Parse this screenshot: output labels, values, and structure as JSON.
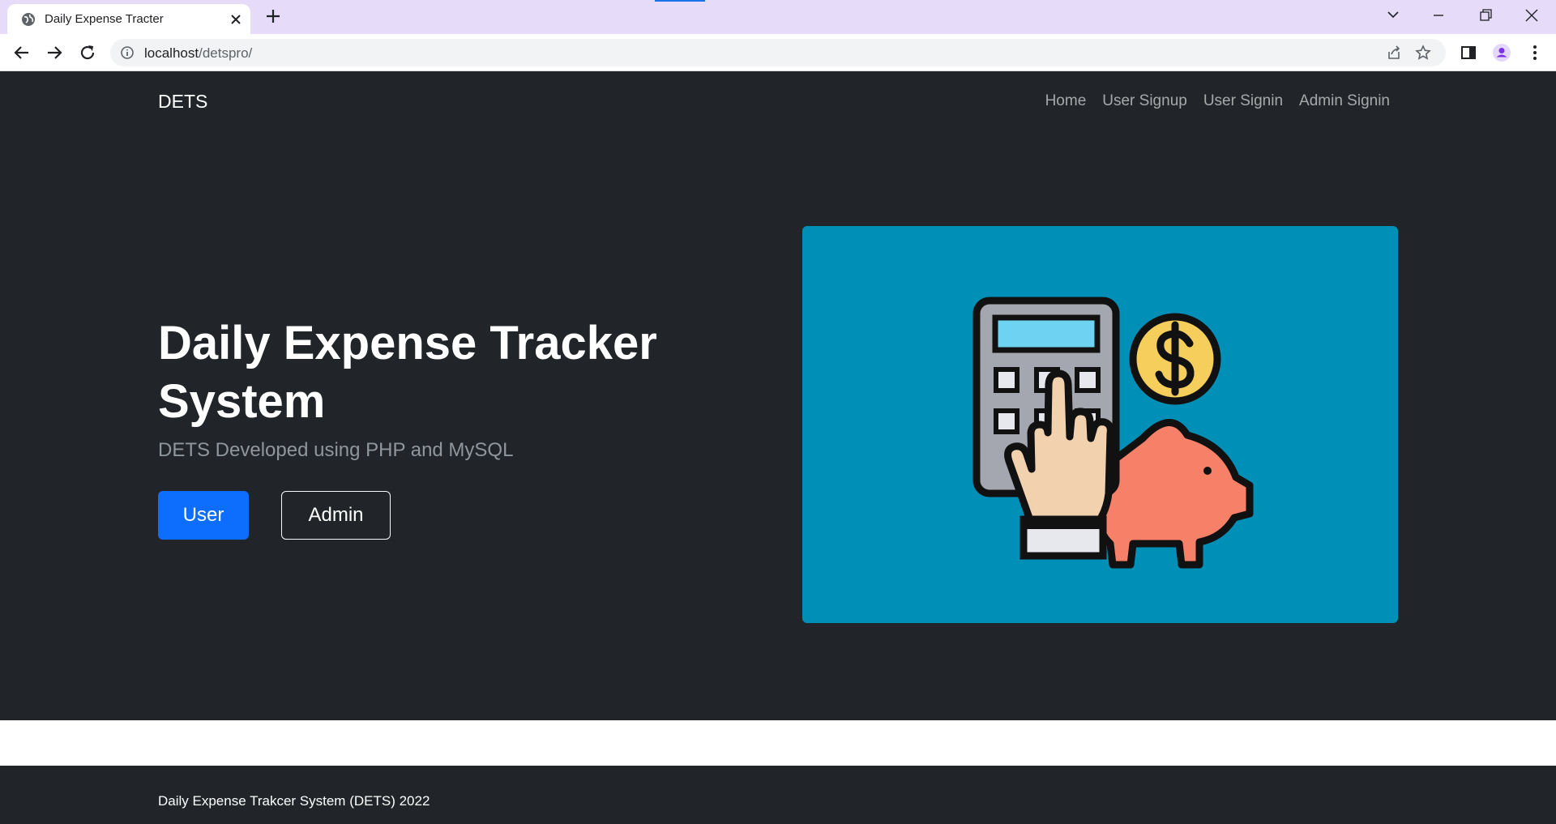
{
  "browser": {
    "tab_title": "Daily Expense Tracter",
    "url_host": "localhost",
    "url_path": "/detspro/"
  },
  "navbar": {
    "brand": "DETS",
    "links": [
      "Home",
      "User Signup",
      "User Signin",
      "Admin Signin"
    ]
  },
  "hero": {
    "title": "Daily Expense Tracker System",
    "subtitle": "DETS Developed using PHP and MySQL",
    "user_button": "User",
    "admin_button": "Admin",
    "image_icon": "calculator-piggy-bank-icon"
  },
  "footer": {
    "text": "Daily Expense Trakcer System (DETS) 2022"
  },
  "colors": {
    "dark_bg": "#212529",
    "primary": "#0d6efd",
    "image_bg": "#0090b7"
  }
}
